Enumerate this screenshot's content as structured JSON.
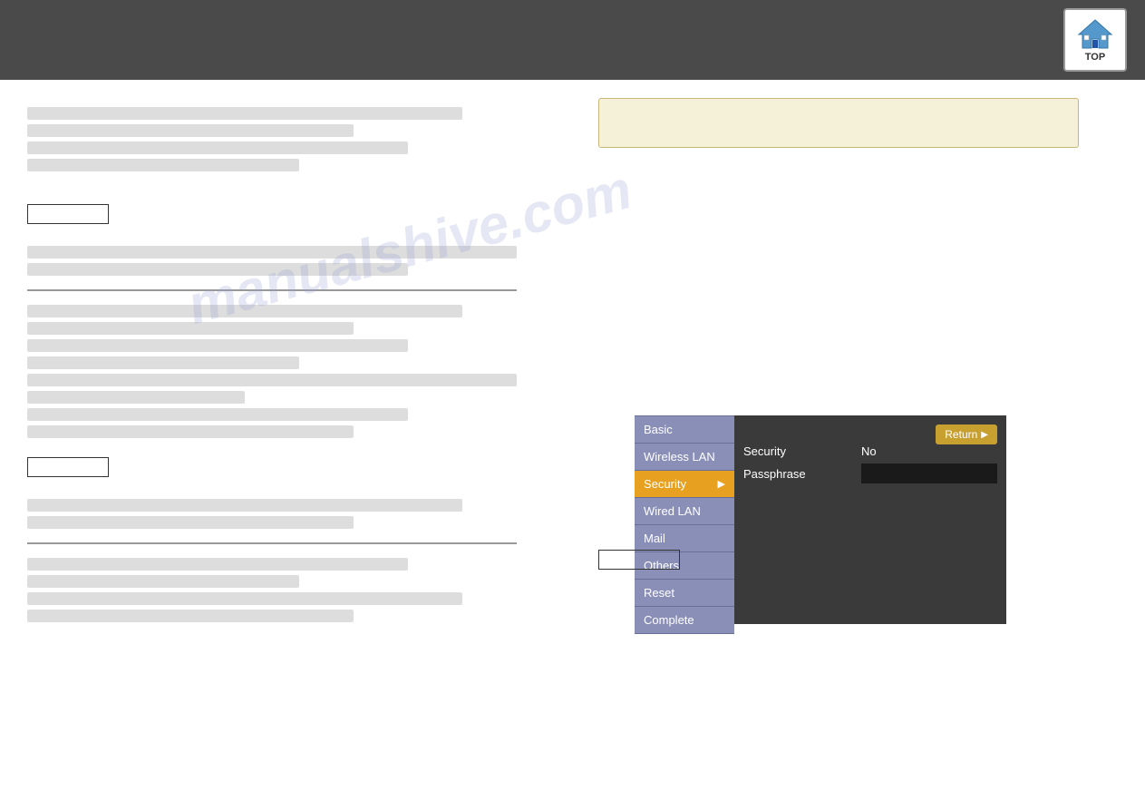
{
  "header": {
    "top_label": "TOP"
  },
  "info_box": {
    "visible": true
  },
  "menu": {
    "items": [
      {
        "id": "basic",
        "label": "Basic",
        "active": false,
        "has_arrow": false
      },
      {
        "id": "wireless-lan",
        "label": "Wireless LAN",
        "active": false,
        "has_arrow": false
      },
      {
        "id": "security",
        "label": "Security",
        "active": true,
        "has_arrow": true
      },
      {
        "id": "wired-lan",
        "label": "Wired LAN",
        "active": false,
        "has_arrow": false
      },
      {
        "id": "mail",
        "label": "Mail",
        "active": false,
        "has_arrow": false
      },
      {
        "id": "others",
        "label": "Others",
        "active": false,
        "has_arrow": false
      },
      {
        "id": "reset",
        "label": "Reset",
        "active": false,
        "has_arrow": false
      },
      {
        "id": "complete",
        "label": "Complete",
        "active": false,
        "has_arrow": false
      }
    ]
  },
  "submenu": {
    "return_label": "Return",
    "rows": [
      {
        "label": "Security",
        "value": "No"
      },
      {
        "label": "Passphrase",
        "value": ""
      }
    ]
  },
  "watermark": {
    "text": "manualshive.com"
  },
  "left_content": {
    "small_box_1": "",
    "small_box_2": ""
  },
  "bottom_box": {
    "label": ""
  }
}
